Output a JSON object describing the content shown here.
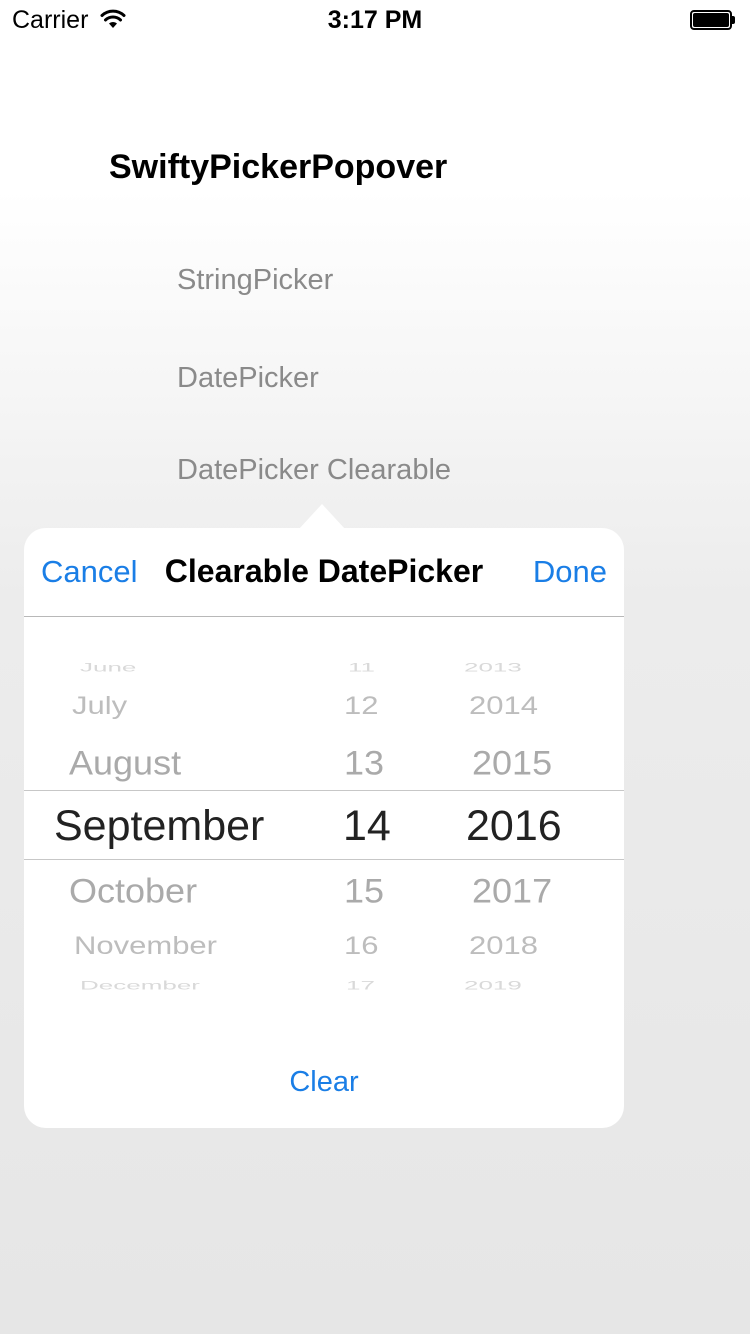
{
  "status_bar": {
    "carrier": "Carrier",
    "time": "3:17 PM"
  },
  "app_title": "SwiftyPickerPopover",
  "menu": [
    "StringPicker",
    "DatePicker",
    "DatePicker Clearable"
  ],
  "popover": {
    "cancel_label": "Cancel",
    "title": "Clearable DatePicker",
    "done_label": "Done",
    "clear_label": "Clear",
    "accent_color": "#1a7ee6"
  },
  "picker": {
    "months": [
      "June",
      "July",
      "August",
      "September",
      "October",
      "November",
      "December"
    ],
    "days": [
      "11",
      "12",
      "13",
      "14",
      "15",
      "16",
      "17"
    ],
    "years": [
      "2013",
      "2014",
      "2015",
      "2016",
      "2017",
      "2018",
      "2019"
    ],
    "selected": {
      "month": "September",
      "day": "14",
      "year": "2016"
    }
  }
}
